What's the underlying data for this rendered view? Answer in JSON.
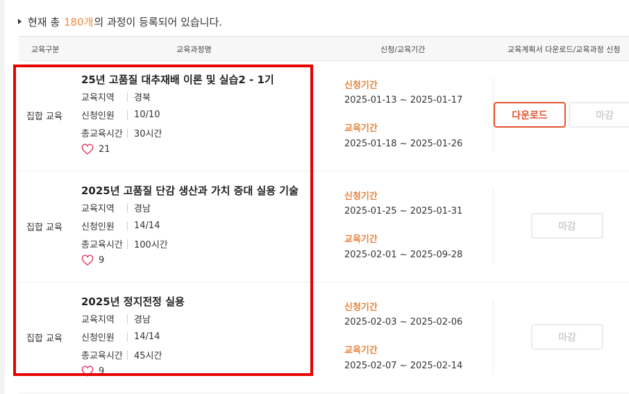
{
  "summary": {
    "prefix": "현재 총 ",
    "count": "180개",
    "suffix": "의 과정이 등록되어 있습니다."
  },
  "table_header": {
    "category": "교육구분",
    "course_name": "교육과정명",
    "period": "신청/교육기간",
    "download_apply": "교육계획서 다운로드/교육과정 신청"
  },
  "labels": {
    "region": "교육지역",
    "applicants": "신청인원",
    "total_hours": "총교육시간",
    "apply_period": "신청기간",
    "edu_period": "교육기간",
    "download": "다운로드",
    "closed": "마감"
  },
  "courses": [
    {
      "category": "집합 교육",
      "title": "25년 고품질 대추재배 이론 및 실습2 - 1기",
      "region": "경북",
      "applicants": "10/10",
      "total_hours": "30시간",
      "likes": "21",
      "apply_period": "2025-01-13 ~ 2025-01-17",
      "edu_period": "2025-01-18 ~ 2025-01-26",
      "has_download": true
    },
    {
      "category": "집합 교육",
      "title": "2025년 고품질 단감 생산과 가치 증대 실용 기술",
      "region": "경남",
      "applicants": "14/14",
      "total_hours": "100시간",
      "likes": "9",
      "apply_period": "2025-01-25 ~ 2025-01-31",
      "edu_period": "2025-02-01 ~ 2025-09-28",
      "has_download": false
    },
    {
      "category": "집합 교육",
      "title": "2025년 정지전정 실용",
      "region": "경남",
      "applicants": "14/14",
      "total_hours": "45시간",
      "likes": "9",
      "apply_period": "2025-02-03 ~ 2025-02-06",
      "edu_period": "2025-02-07 ~ 2025-02-14",
      "has_download": false
    }
  ],
  "colors": {
    "accent_orange": "#e8823a",
    "download_red": "#e0542f",
    "highlight_red": "#e60000",
    "heart_pink": "#e0406a"
  },
  "icons": {
    "heart": "heart-outline-icon",
    "bullet": "triangle-bullet-icon"
  }
}
